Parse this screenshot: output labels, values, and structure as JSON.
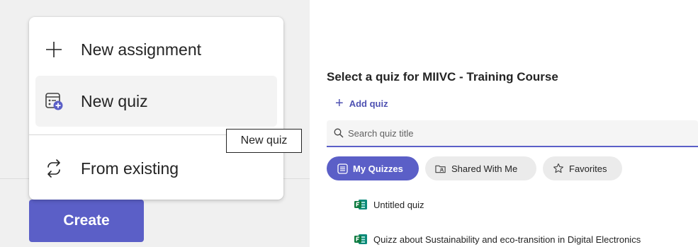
{
  "menu": {
    "items": [
      {
        "label": "New assignment",
        "icon": "plus-icon"
      },
      {
        "label": "New quiz",
        "icon": "quiz-icon"
      },
      {
        "label": "From existing",
        "icon": "repeat-icon"
      }
    ]
  },
  "tooltip": {
    "text": "New quiz"
  },
  "create_button": {
    "label": "Create"
  },
  "quiz_picker": {
    "title": "Select a quiz for MIIVC - Training Course",
    "add_quiz_label": "Add quiz",
    "search": {
      "placeholder": "Search quiz title",
      "value": ""
    },
    "tabs": [
      {
        "label": "My Quizzes",
        "icon": "list-icon",
        "active": true
      },
      {
        "label": "Shared With Me",
        "icon": "shared-folder-icon",
        "active": false
      },
      {
        "label": "Favorites",
        "icon": "star-icon",
        "active": false
      }
    ],
    "quizzes": [
      {
        "title": "Untitled quiz",
        "icon": "forms-icon"
      },
      {
        "title": "Quizz about Sustainability and eco-transition in Digital Electronics",
        "icon": "forms-icon"
      }
    ]
  },
  "colors": {
    "accent": "#5b5fc7",
    "accent_text": "#4f52b2",
    "forms_green": "#107c41",
    "forms_teal": "#0b8a7a"
  }
}
